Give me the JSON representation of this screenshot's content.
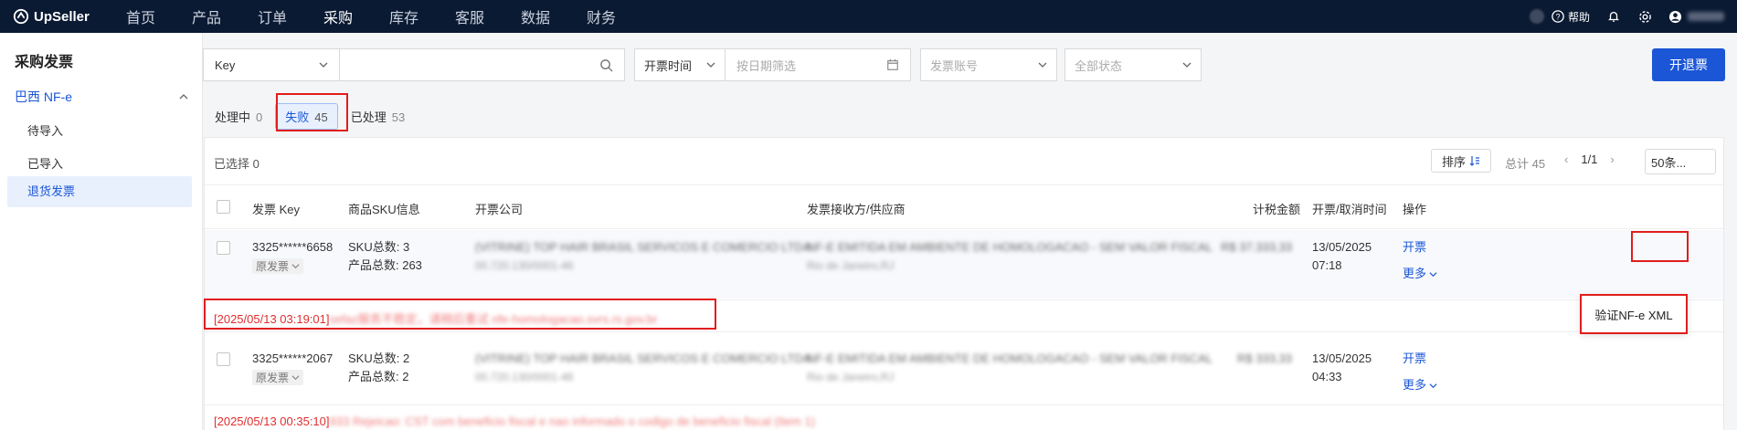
{
  "nav": {
    "logo": "UpSeller",
    "menu": [
      "首页",
      "产品",
      "订单",
      "采购",
      "库存",
      "客服",
      "数据",
      "财务"
    ],
    "active_index": 3,
    "help": "帮助"
  },
  "sidebar": {
    "title": "采购发票",
    "group": "巴西 NF-e",
    "items": [
      "待导入",
      "已导入",
      "退货发票"
    ],
    "active_index": 2
  },
  "filters": {
    "key_select": "Key",
    "key_input_placeholder": "",
    "date_type": "开票时间",
    "date_placeholder": "按日期筛选",
    "account_placeholder": "发票账号",
    "status_placeholder": "全部状态"
  },
  "primary_button": "开退票",
  "tabs": [
    {
      "label": "处理中",
      "count": "0"
    },
    {
      "label": "失败",
      "count": "45"
    },
    {
      "label": "已处理",
      "count": "53"
    }
  ],
  "toolbar": {
    "selected": "已选择 0",
    "sort": "排序",
    "total": "总计 45",
    "page": "1/1",
    "page_size": "50条..."
  },
  "columns": [
    "发票 Key",
    "商品SKU信息",
    "开票公司",
    "发票接收方/供应商",
    "计税金额",
    "开票/取消时间",
    "操作"
  ],
  "rows": [
    {
      "key": "3325******6658",
      "tag": "原发票",
      "sku_total": "SKU总数: 3",
      "product_total": "产品总数: 263",
      "company": "(VITRINE) TOP HAIR BRASIL SERVICOS E COMERCIO LTDA",
      "company_sub": "00.720.130/0001-46",
      "receiver": "NF-E EMITIDA EM AMBIENTE DE HOMOLOGACAO - SEM VALOR FISCAL",
      "receiver_sub": "Rio de Janeiro,RJ",
      "amount": "R$ 37.333,33",
      "date": "13/05/2025",
      "time": "07:18",
      "action": "开票",
      "more": "更多",
      "error_time": "[2025/05/13 03:19:01]",
      "error_msg": "sefaz服务不稳定，请稍后重试 nfe-homologacao.svrs.rs.gov.br"
    },
    {
      "key": "3325******2067",
      "tag": "原发票",
      "sku_total": "SKU总数: 2",
      "product_total": "产品总数: 2",
      "company": "(VITRINE) TOP HAIR BRASIL SERVICOS E COMERCIO LTDA",
      "company_sub": "00.720.130/0001-46",
      "receiver": "NF-E EMITIDA EM AMBIENTE DE HOMOLOGACAO - SEM VALOR FISCAL",
      "receiver_sub": "Rio de Janeiro,RJ",
      "amount": "R$ 333,33",
      "date": "13/05/2025",
      "time": "04:33",
      "action": "开票",
      "more": "更多",
      "error_time": "[2025/05/13 00:35:10]",
      "error_msg": "933 Rejeicao: CST com beneficio fiscal e nao informado o codigo de beneficio fiscal (Item 1)"
    }
  ],
  "popover": "验证NF-e XML"
}
